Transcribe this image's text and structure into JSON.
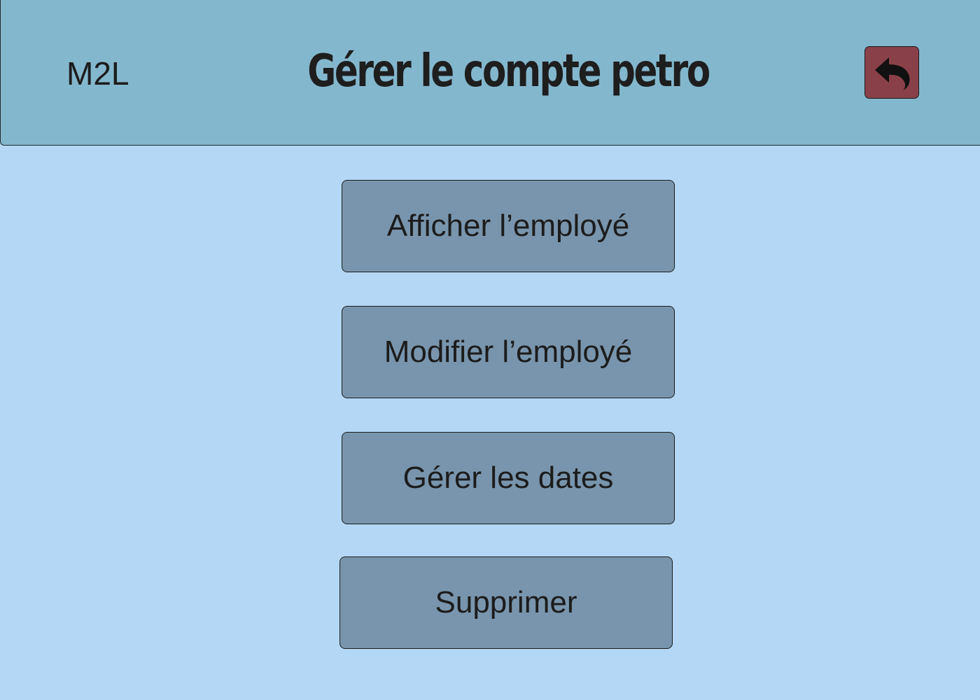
{
  "header": {
    "brand": "M2L",
    "title": "Gérer le compte petro",
    "back_button": {
      "icon": "undo-arrow-icon",
      "color": "#8a4048"
    }
  },
  "actions": [
    {
      "label": "Afficher l’employé"
    },
    {
      "label": "Modifier l’employé"
    },
    {
      "label": "Gérer les dates"
    },
    {
      "label": "Supprimer"
    }
  ],
  "colors": {
    "background": "#b3d7f5",
    "header": "#83b7cd",
    "button": "#7895ad"
  }
}
